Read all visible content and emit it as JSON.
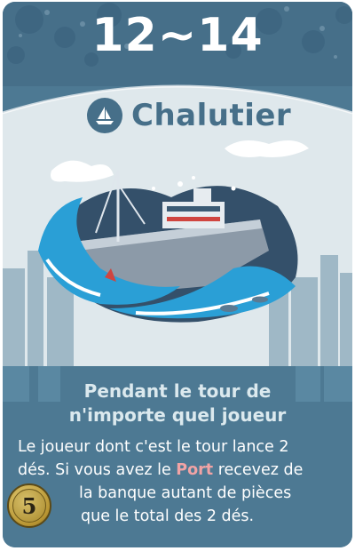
{
  "card": {
    "activation_numbers": "12~14",
    "name": "Chalutier",
    "type_icon": "sailboat-icon",
    "activation_text": [
      "Pendant le tour de",
      "n'importe quel joueur"
    ],
    "effect": {
      "line1": "Le joueur dont c'est le tour lance 2",
      "line2_before": "dés. Si vous avez le ",
      "line2_highlight": "Port",
      "line2_after": " recevez de",
      "line3": "la banque autant de pièces",
      "line4": "que le total des 2 dés."
    },
    "cost": "5"
  },
  "colors": {
    "card_blue": "#4d7993",
    "banner_blue": "#466f89",
    "panel_light": "#dfe8ec",
    "text_light": "#dbe9ee",
    "port_highlight": "#f1a3a5",
    "wave_blue": "#2a9fd6",
    "coin_gold": "#b89532"
  }
}
